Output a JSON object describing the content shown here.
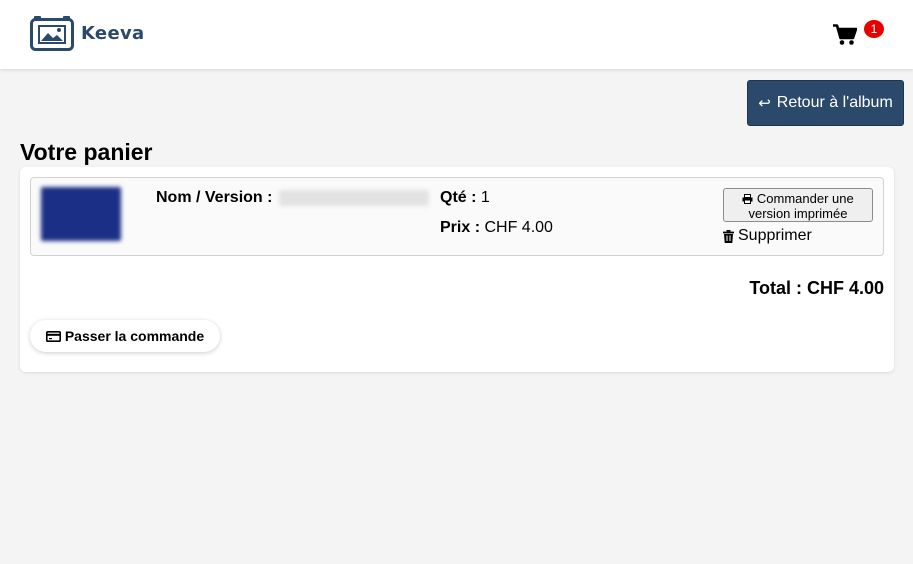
{
  "app": {
    "name": "Keeva",
    "logo_icon": "photo-frame-icon",
    "brand_color": "#2b4a6b"
  },
  "header": {
    "cart_icon": "shopping-cart-icon",
    "cart_count": "1",
    "badge_color": "#e60000"
  },
  "nav": {
    "back_label": "Retour à l'album",
    "back_icon": "return-arrow-icon",
    "back_arrow": "↩"
  },
  "page": {
    "title": "Votre panier"
  },
  "cart": {
    "items": [
      {
        "thumbnail_icon": "photo-thumbnail",
        "name_label": "Nom / Version :",
        "name_value": "",
        "qty_label": "Qté :",
        "qty_value": "1",
        "price_label": "Prix :",
        "price_value": "CHF 4.00",
        "print_button_label": "Commander une version imprimée",
        "print_icon": "printer-icon",
        "delete_label": "Supprimer",
        "delete_icon": "trash-icon"
      }
    ],
    "total": "Total : CHF 4.00",
    "checkout_label": "Passer la commande",
    "checkout_icon": "credit-card-icon"
  }
}
